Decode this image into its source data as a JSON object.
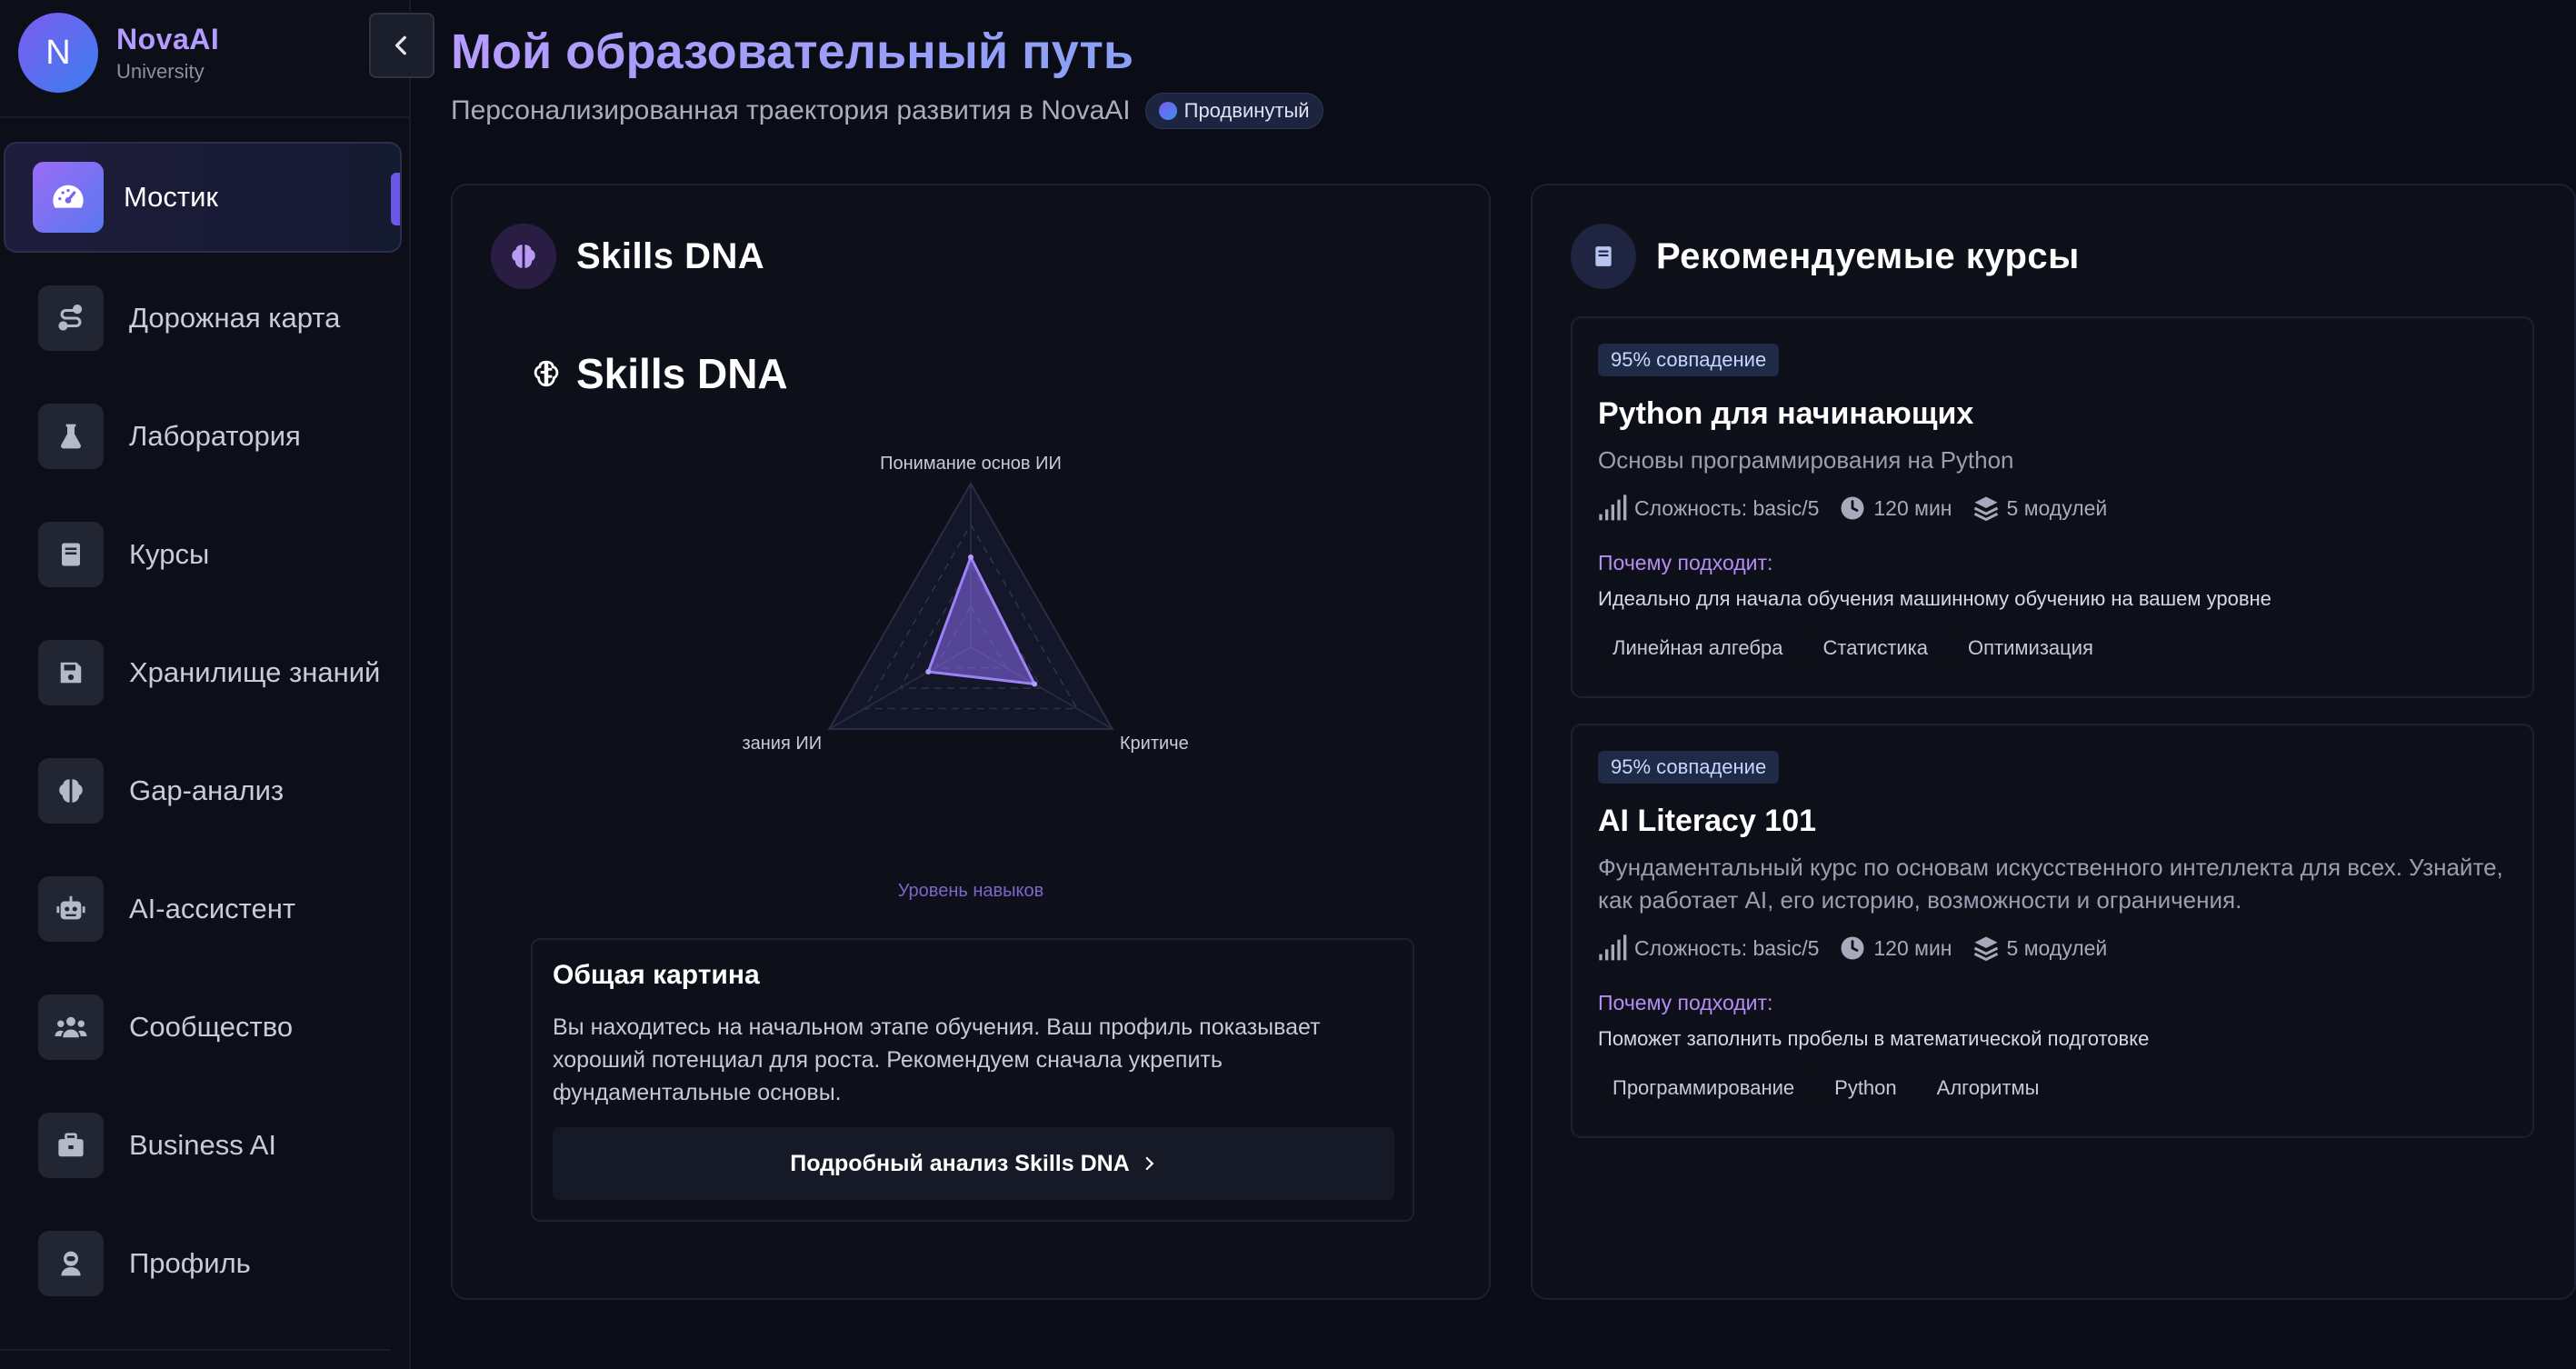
{
  "brand": {
    "initial": "N",
    "name": "NovaAI",
    "sub": "University"
  },
  "nav": [
    {
      "label": "Мостик",
      "icon": "dashboard-gauge-icon",
      "active": true
    },
    {
      "label": "Дорожная карта",
      "icon": "route-icon"
    },
    {
      "label": "Лаборатория",
      "icon": "flask-icon"
    },
    {
      "label": "Курсы",
      "icon": "book-icon"
    },
    {
      "label": "Хранилище знаний",
      "icon": "floppy-disk-icon"
    },
    {
      "label": "Gap-анализ",
      "icon": "brain-icon"
    },
    {
      "label": "AI-ассистент",
      "icon": "robot-icon"
    },
    {
      "label": "Сообщество",
      "icon": "users-icon"
    },
    {
      "label": "Business AI",
      "icon": "briefcase-icon"
    },
    {
      "label": "Профиль",
      "icon": "user-astronaut-icon"
    }
  ],
  "header": {
    "title": "Мой образовательный путь",
    "subtitle": "Персонализированная траектория развития в NovaAI",
    "level_badge": "Продвинутый"
  },
  "skills_card": {
    "title": "Skills DNA",
    "inner_title": "Skills DNA",
    "chart_data": {
      "type": "radar",
      "axes": [
        "Понимание основ ИИ",
        "Критиче",
        "зания ИИ"
      ],
      "max": 100,
      "values": [
        55,
        45,
        30
      ],
      "legend_label": "Уровень навыков",
      "series_color": "#8b6df0"
    },
    "overview": {
      "title": "Общая картина",
      "text": "Вы находитесь на начальном этапе обучения. Ваш профиль показывает хороший потенциал для роста. Рекомендуем сначала укрепить фундаментальные основы.",
      "button": "Подробный анализ Skills DNA"
    }
  },
  "courses_card": {
    "title": "Рекомендуемые курсы",
    "courses": [
      {
        "match": "95% совпадение",
        "title": "Python для начинающих",
        "description": "Основы программирования на Python",
        "difficulty": "Сложность: basic/5",
        "duration": "120 мин",
        "modules": "5 модулей",
        "why_label": "Почему подходит:",
        "why_text": "Идеально для начала обучения машинному обучению на вашем уровне",
        "tags": [
          "Линейная алгебра",
          "Статистика",
          "Оптимизация"
        ]
      },
      {
        "match": "95% совпадение",
        "title": "AI Literacy 101",
        "description": "Фундаментальный курс по основам искусственного интеллекта для всех. Узнайте, как работает AI, его историю, возможности и ограничения.",
        "difficulty": "Сложность: basic/5",
        "duration": "120 мин",
        "modules": "5 модулей",
        "why_label": "Почему подходит:",
        "why_text": "Поможет заполнить пробелы в математической подготовке",
        "tags": [
          "Программирование",
          "Python",
          "Алгоритмы"
        ]
      }
    ]
  },
  "colors": {
    "accent": "#8b6df0",
    "background": "#0b0d16",
    "card": "#0e1019"
  }
}
